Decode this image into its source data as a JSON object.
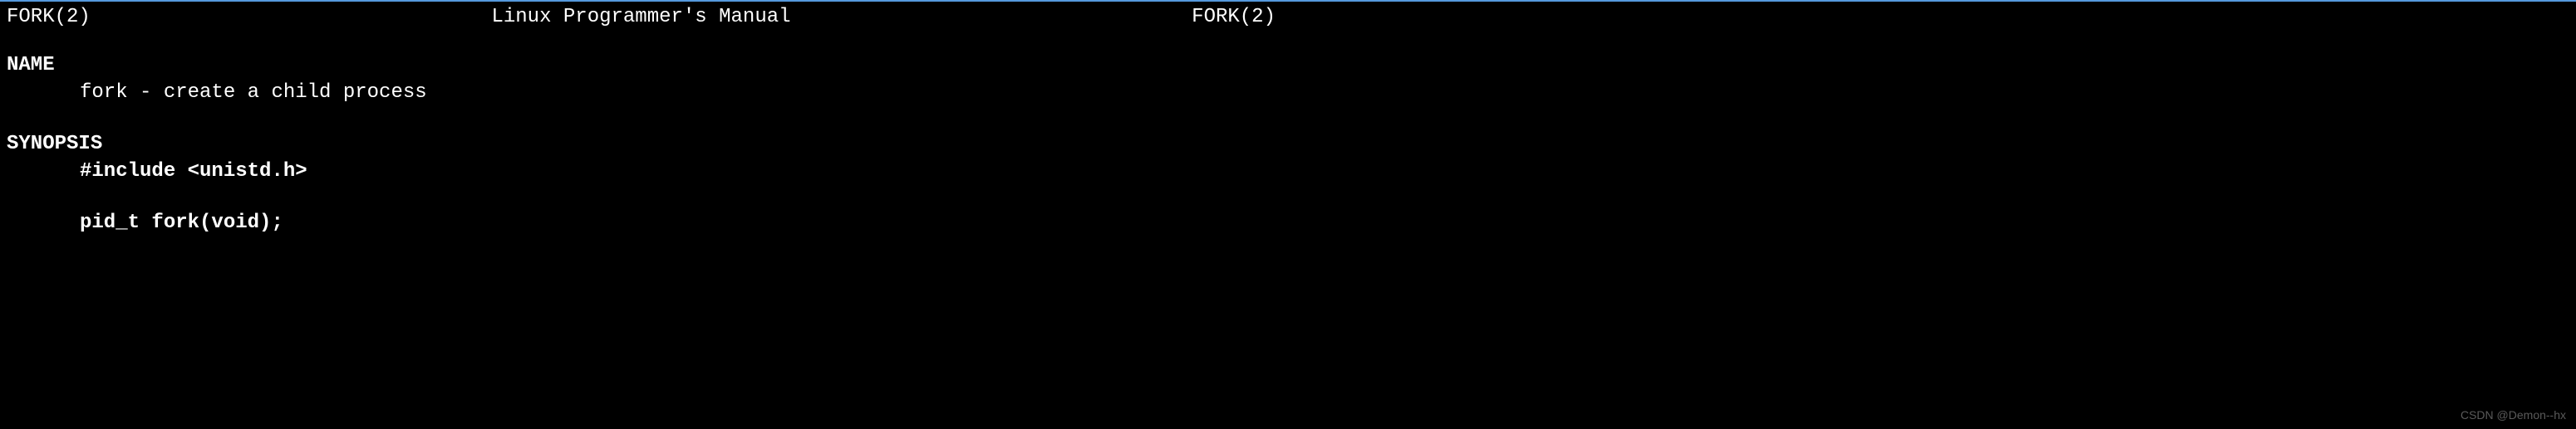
{
  "header": {
    "left": "FORK(2)",
    "center": "Linux Programmer's Manual",
    "right": "FORK(2)"
  },
  "sections": {
    "name_heading": "NAME",
    "name_body": "fork - create a child process",
    "synopsis_heading": "SYNOPSIS",
    "synopsis_include": "#include <unistd.h>",
    "synopsis_decl": "pid_t fork(void);"
  },
  "watermark": "CSDN @Demon--hx"
}
